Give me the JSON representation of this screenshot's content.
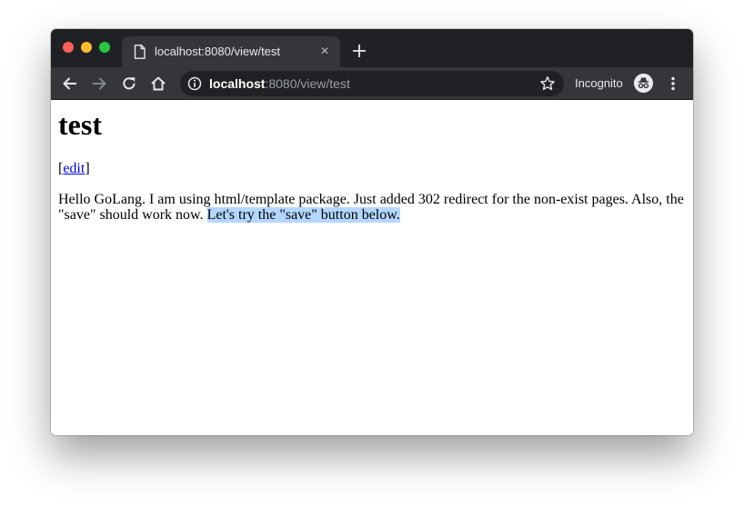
{
  "browser": {
    "tab": {
      "title": "localhost:8080/view/test",
      "close_glyph": "×"
    },
    "toolbar": {
      "url_host": "localhost",
      "url_rest": ":8080/view/test",
      "incognito_label": "Incognito"
    },
    "icons": {
      "back": "arrow-left-icon",
      "forward": "arrow-right-icon",
      "reload": "reload-icon",
      "home": "home-icon",
      "info": "info-icon",
      "star": "star-icon",
      "incognito": "incognito-icon",
      "menu": "kebab-menu-icon",
      "new_tab": "plus-icon",
      "page": "page-icon"
    },
    "colors": {
      "tabstrip": "#202124",
      "toolbar": "#35363a",
      "selection": "#b3d7ff",
      "link": "#0000ee"
    }
  },
  "page": {
    "heading": "test",
    "edit_open": "[",
    "edit_link": "edit",
    "edit_close": "]",
    "body_text": "Hello GoLang. I am using html/template package. Just added 302 redirect for the non-exist pages. Also, the \"save\" should work now. ",
    "body_selected": "Let's try the \"save\" button below."
  }
}
